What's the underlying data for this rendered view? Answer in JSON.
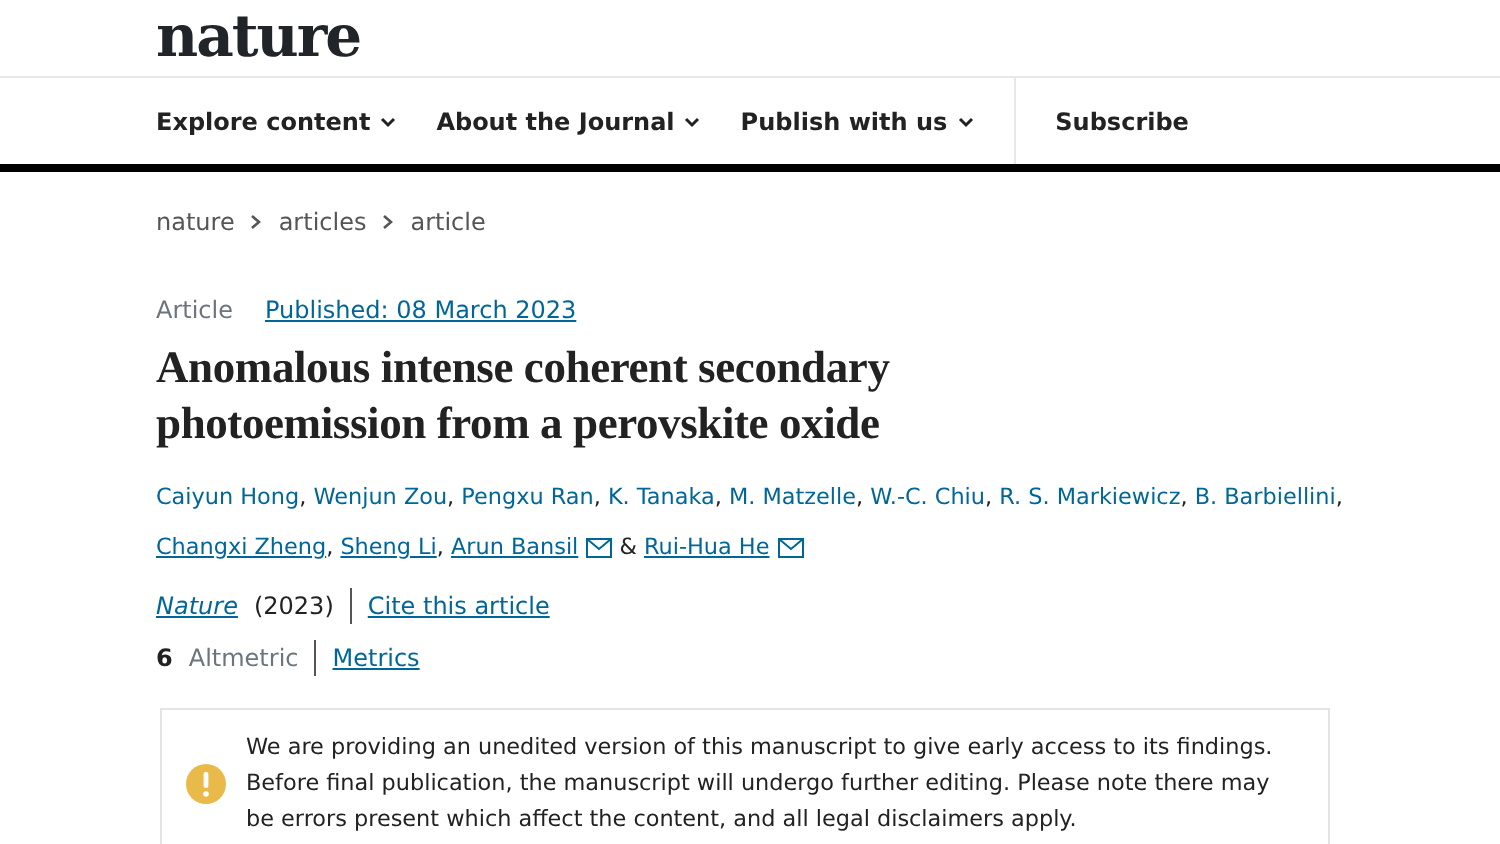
{
  "logo": "nature",
  "nav": [
    {
      "label": "Explore content",
      "dropdown": true
    },
    {
      "label": "About the Journal",
      "dropdown": true
    },
    {
      "label": "Publish with us",
      "dropdown": true
    },
    {
      "label": "Subscribe",
      "dropdown": false
    }
  ],
  "breadcrumb": [
    "nature",
    "articles",
    "article"
  ],
  "article_type": "Article",
  "published": "Published: 08 March 2023",
  "title": "Anomalous intense coherent secondary photoemission from a perovskite oxide",
  "authors": [
    {
      "name": "Caiyun Hong",
      "sep": ",",
      "underlined": false,
      "email": false
    },
    {
      "name": "Wenjun Zou",
      "sep": ",",
      "underlined": false,
      "email": false
    },
    {
      "name": "Pengxu Ran",
      "sep": ",",
      "underlined": false,
      "email": false
    },
    {
      "name": "K. Tanaka",
      "sep": ",",
      "underlined": false,
      "email": false
    },
    {
      "name": "M. Matzelle",
      "sep": ",",
      "underlined": false,
      "email": false
    },
    {
      "name": "W.-C. Chiu",
      "sep": ",",
      "underlined": false,
      "email": false
    },
    {
      "name": "R. S. Markiewicz",
      "sep": ",",
      "underlined": false,
      "email": false
    },
    {
      "name": "B. Barbiellini",
      "sep": ",",
      "underlined": false,
      "email": false
    },
    {
      "name": "Changxi Zheng",
      "sep": ",",
      "underlined": true,
      "email": false
    },
    {
      "name": "Sheng Li",
      "sep": ",",
      "underlined": true,
      "email": false
    },
    {
      "name": "Arun Bansil",
      "sep": "&",
      "underlined": true,
      "email": true
    },
    {
      "name": "Rui-Hua He",
      "underlined": true,
      "email": true
    }
  ],
  "journal": "Nature",
  "year": "(2023)",
  "cite_link": "Cite this article",
  "altmetric_score": "6",
  "altmetric_label": "Altmetric",
  "metrics_link": "Metrics",
  "notice": "We are providing an unedited version of this manuscript to give early access to its findings. Before final publication, the manuscript will undergo further editing. Please note there may be errors present which affect the content, and all legal disclaimers apply."
}
